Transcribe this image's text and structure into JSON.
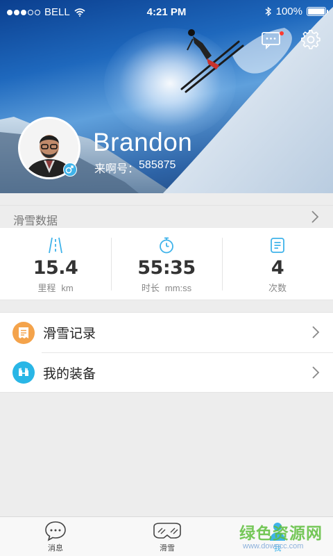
{
  "status_bar": {
    "carrier": "BELL",
    "time": "4:21 PM",
    "battery": "100%"
  },
  "profile": {
    "name": "Brandon",
    "id_label": "来啊号：",
    "id_value": "585875"
  },
  "ski_data": {
    "title": "滑雪数据",
    "stats": [
      {
        "value": "15.4",
        "label": "里程",
        "unit": "km",
        "icon": "road-icon"
      },
      {
        "value": "55:35",
        "label": "时长",
        "unit": "mm:ss",
        "icon": "stopwatch-icon"
      },
      {
        "value": "4",
        "label": "次数",
        "unit": "",
        "icon": "count-icon"
      }
    ]
  },
  "menu": [
    {
      "label": "滑雪记录",
      "icon": "receipt-icon",
      "color": "#f4a34b"
    },
    {
      "label": "我的装备",
      "icon": "glove-icon",
      "color": "#29b6e6"
    }
  ],
  "tabbar": {
    "items": [
      {
        "label": "消息"
      },
      {
        "label": "滑雪"
      },
      {
        "label": "我"
      }
    ]
  },
  "watermark": {
    "text": "绿色资源网",
    "sub": "www.downcc.com"
  },
  "colors": {
    "accent": "#3fb3ea",
    "record": "#f4a34b",
    "gear": "#29b6e6",
    "badge": "#ff3b30"
  }
}
